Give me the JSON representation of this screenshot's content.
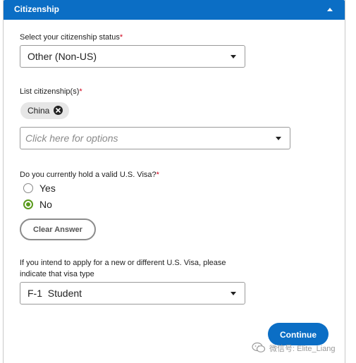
{
  "section": {
    "title": "Citizenship"
  },
  "citizenship_status": {
    "label": "Select your citizenship status",
    "required_mark": "*",
    "selected": "Other (Non-US)"
  },
  "citizenships": {
    "label": "List citizenship(s)",
    "required_mark": "*",
    "chips": [
      "China"
    ],
    "placeholder": "Click here for options"
  },
  "visa_question": {
    "label": "Do you currently hold a valid U.S. Visa?",
    "required_mark": "*",
    "options": [
      {
        "label": "Yes",
        "checked": false
      },
      {
        "label": "No",
        "checked": true
      }
    ],
    "clear_label": "Clear Answer"
  },
  "visa_type": {
    "label_line1": "If you intend to apply for a new or different U.S. Visa, please",
    "label_line2": "indicate that visa type",
    "selected": "F-1  Student"
  },
  "actions": {
    "continue_label": "Continue"
  },
  "watermark": {
    "text": "微信号: Elite_Liang"
  },
  "colors": {
    "primary": "#0b6ec5",
    "required": "#d0021b",
    "radio_checked": "#5a9a1c"
  }
}
